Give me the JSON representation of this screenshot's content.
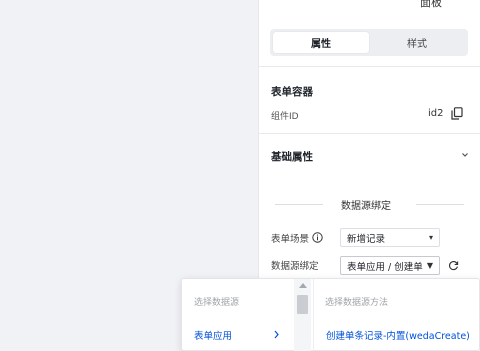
{
  "header": {
    "top_cut_label": "面板"
  },
  "tabs": [
    {
      "label": "属性",
      "active": true
    },
    {
      "label": "样式",
      "active": false
    }
  ],
  "form_container": {
    "title": "表单容器",
    "component_id_label": "组件ID",
    "component_id_value": "id2"
  },
  "basic_props": {
    "title": "基础属性"
  },
  "data_binding": {
    "title": "数据源绑定",
    "scene_label": "表单场景",
    "scene_value": "新增记录",
    "source_label": "数据源绑定",
    "source_value": "表单应用 / 创建单"
  },
  "dropdown": {
    "left_header": "选择数据源",
    "left_item": "表单应用",
    "right_header": "选择数据源方法",
    "right_item": "创建单条记录-内置(wedaCreate)"
  },
  "colors": {
    "accent": "#0052d9",
    "canvas_bg": "#f1f2f5",
    "tab_bg": "#eceef1"
  }
}
